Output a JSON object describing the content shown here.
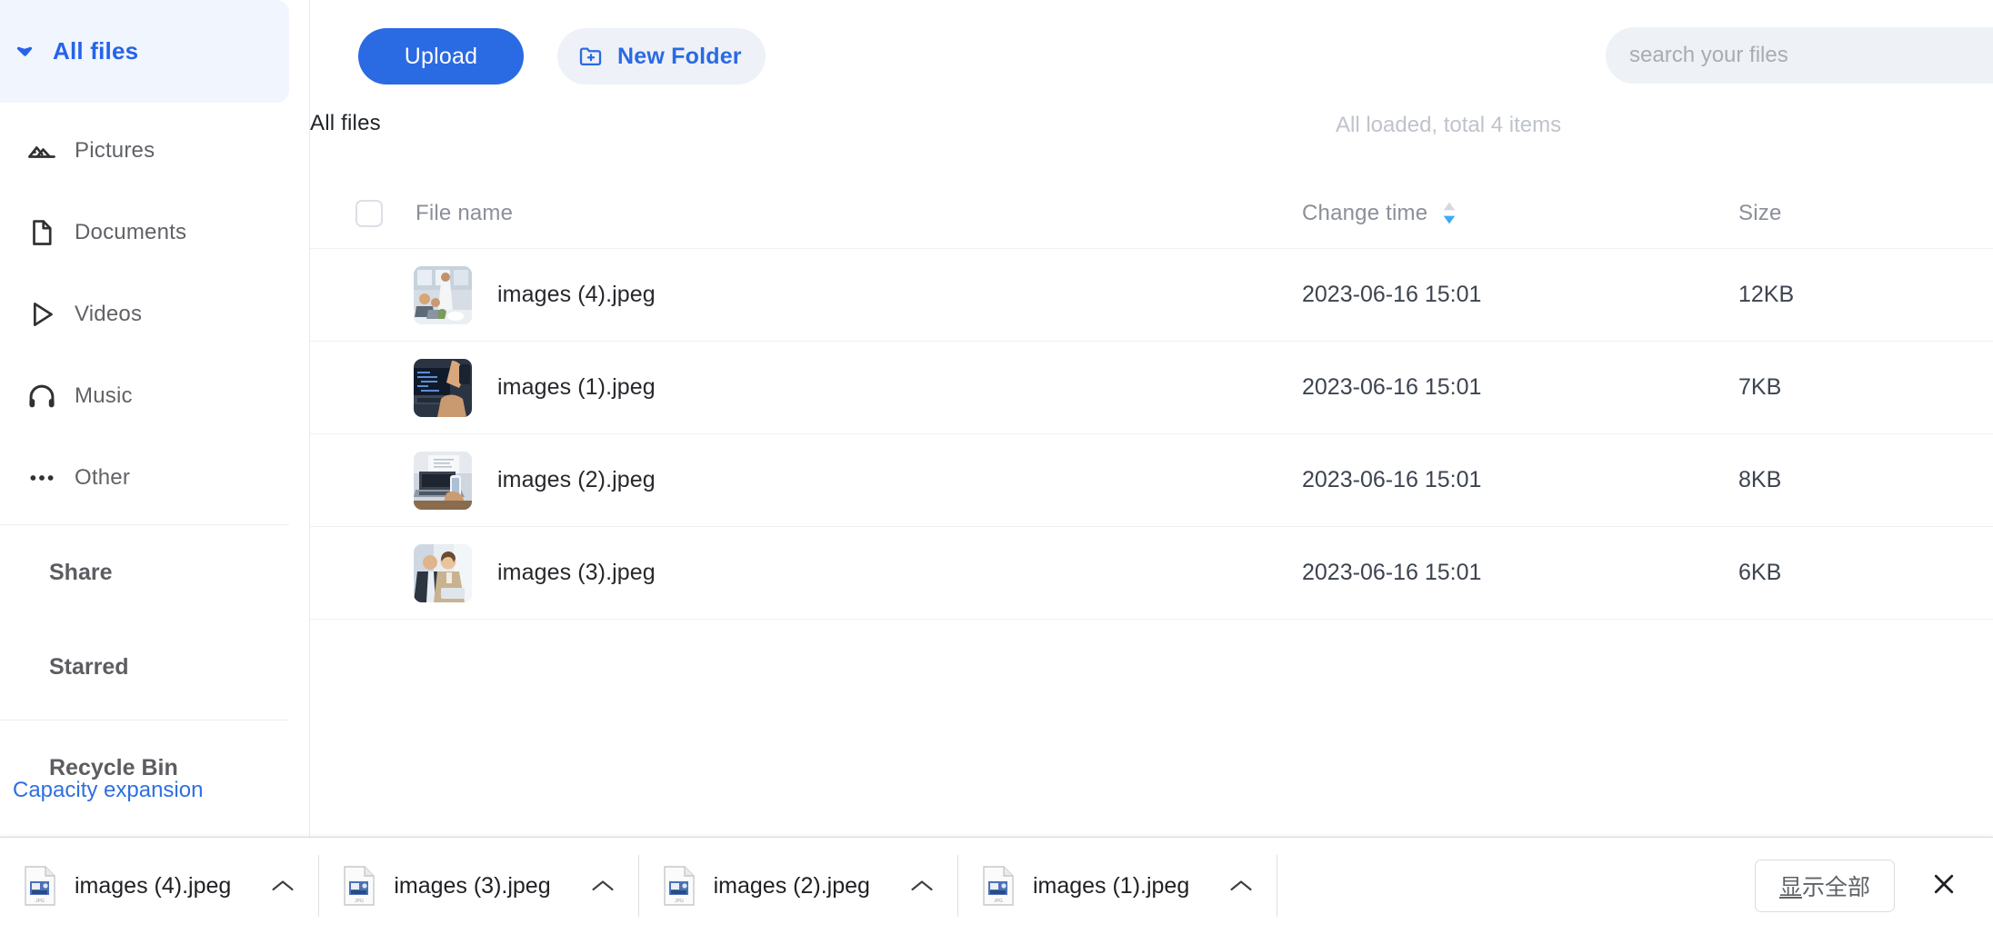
{
  "colors": {
    "accent": "#2a6ae3",
    "accent_light_bg": "#f1f5fe",
    "sidebar_label": "#606266",
    "muted": "#8b8f99",
    "note": "#bfc3cb"
  },
  "sidebar": {
    "header": {
      "label": "All files",
      "icon": "caret-down-icon",
      "active": true
    },
    "items": [
      {
        "label": "Pictures",
        "icon": "pictures-icon"
      },
      {
        "label": "Documents",
        "icon": "document-icon"
      },
      {
        "label": "Videos",
        "icon": "play-icon"
      },
      {
        "label": "Music",
        "icon": "headphones-icon"
      },
      {
        "label": "Other",
        "icon": "ellipsis-icon"
      }
    ],
    "groups": [
      {
        "label": "Share"
      },
      {
        "label": "Starred"
      },
      {
        "label": "Recycle Bin"
      }
    ],
    "capacity_link": "Capacity expansion"
  },
  "toolbar": {
    "upload_label": "Upload",
    "new_folder_label": "New Folder",
    "new_folder_icon": "folder-plus-icon"
  },
  "search": {
    "placeholder": "search your files",
    "value": "",
    "icon": "search-icon"
  },
  "main": {
    "section_title": "All files",
    "loaded_note": "All loaded, total 4 items"
  },
  "table": {
    "headers": {
      "file_name": "File name",
      "change_time": "Change time",
      "size": "Size"
    },
    "sort": {
      "column": "change_time",
      "direction": "desc",
      "icon": "sort-arrows-icon"
    },
    "select_all_checked": false,
    "rows": [
      {
        "name": "images (4).jpeg",
        "time": "2023-06-16 15:01",
        "size": "12KB",
        "thumb": "office-meeting-photo"
      },
      {
        "name": "images (1).jpeg",
        "time": "2023-06-16 15:01",
        "size": "7KB",
        "thumb": "laptop-code-photo"
      },
      {
        "name": "images (2).jpeg",
        "time": "2023-06-16 15:01",
        "size": "8KB",
        "thumb": "laptop-phone-photo"
      },
      {
        "name": "images (3).jpeg",
        "time": "2023-06-16 15:01",
        "size": "6KB",
        "thumb": "two-people-photo"
      }
    ]
  },
  "download_bar": {
    "items": [
      {
        "name": "images (4).jpeg",
        "icon": "jpeg-file-icon",
        "menu_icon": "chevron-up-icon"
      },
      {
        "name": "images (3).jpeg",
        "icon": "jpeg-file-icon",
        "menu_icon": "chevron-up-icon"
      },
      {
        "name": "images (2).jpeg",
        "icon": "jpeg-file-icon",
        "menu_icon": "chevron-up-icon"
      },
      {
        "name": "images (1).jpeg",
        "icon": "jpeg-file-icon",
        "menu_icon": "chevron-up-icon"
      }
    ],
    "show_all_label": "显示全部",
    "show_all_underline_char": "显",
    "close_icon": "close-icon"
  }
}
